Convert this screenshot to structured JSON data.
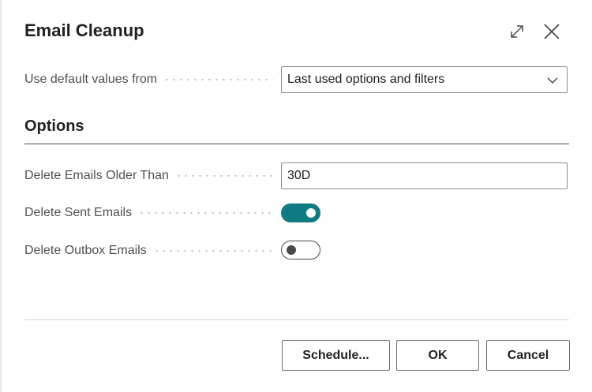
{
  "dialog": {
    "title": "Email Cleanup",
    "expand_icon": "expand-icon",
    "close_icon": "close-icon"
  },
  "defaults": {
    "label": "Use default values from",
    "value": "Last used options and filters"
  },
  "options": {
    "section_title": "Options",
    "older_than": {
      "label": "Delete Emails Older Than",
      "value": "30D"
    },
    "sent_emails": {
      "label": "Delete Sent Emails",
      "enabled": true
    },
    "outbox_emails": {
      "label": "Delete Outbox Emails",
      "enabled": false
    }
  },
  "footer": {
    "schedule_label": "Schedule...",
    "ok_label": "OK",
    "cancel_label": "Cancel"
  },
  "colors": {
    "accent": "#0f7c83",
    "text": "#212121",
    "label": "#505050"
  }
}
